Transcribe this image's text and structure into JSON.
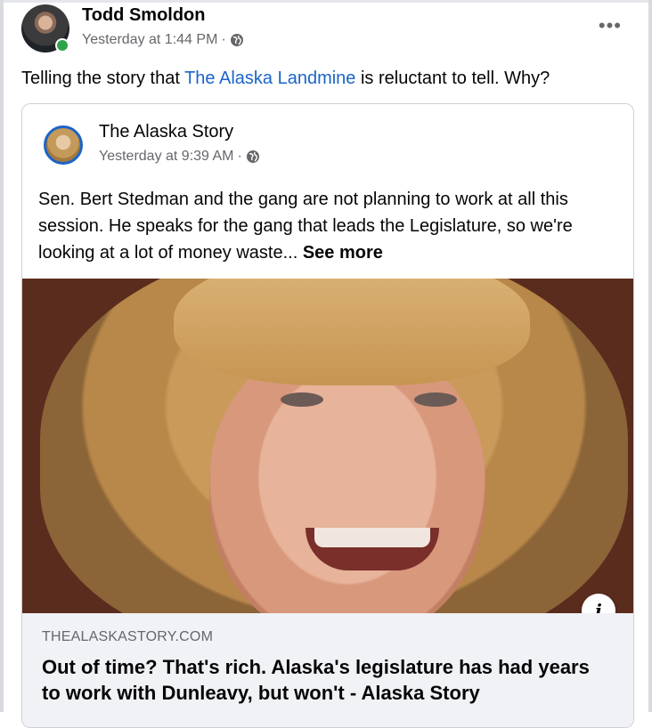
{
  "post": {
    "author": "Todd Smoldon",
    "timestamp": "Yesterday at 1:44 PM",
    "separator": "·",
    "more_glyph": "•••",
    "text_before": "Telling the story that ",
    "text_link": "The Alaska Landmine",
    "text_after": " is reluctant to tell. Why?"
  },
  "shared": {
    "author": "The Alaska Story",
    "timestamp": "Yesterday at 9:39 AM",
    "separator": "·",
    "body": "Sen. Bert Stedman and the gang are not planning to work at all this session. He speaks for the gang that leads the Legislature, so we're looking at a lot of money waste... ",
    "see_more": "See more",
    "info_glyph": "i",
    "link_domain": "THEALASKASTORY.COM",
    "link_title": "Out of time? That's rich. Alaska's legislature has had years to work with Dunleavy, but won't - Alaska Story"
  },
  "icons": {
    "globe": "globe-icon",
    "more": "more-options-icon",
    "info": "info-icon"
  },
  "colors": {
    "link": "#1b64c7",
    "meta": "#65676b",
    "online": "#31a24c",
    "preview_bg": "#f0f2f5"
  }
}
